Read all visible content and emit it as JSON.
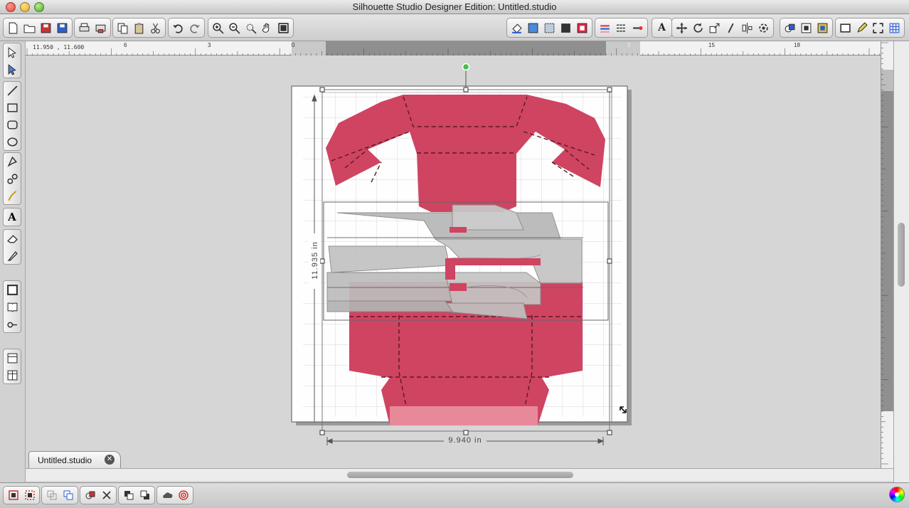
{
  "window": {
    "title": "Silhouette Studio Designer Edition: Untitled.studio"
  },
  "toolbar": {
    "file_buttons": [
      "new-document-icon",
      "open-folder-icon",
      "save-icon",
      "save-to-library-icon"
    ],
    "print_buttons": [
      "print-icon",
      "print-and-cut-icon"
    ],
    "clipboard_buttons": [
      "copy-icon",
      "paste-icon",
      "cut-icon"
    ],
    "history_buttons": [
      "undo-icon",
      "redo-icon"
    ],
    "zoom_buttons": [
      "zoom-in-icon",
      "zoom-out-icon",
      "zoom-select-icon",
      "pan-icon",
      "fit-to-page-icon"
    ],
    "fill_buttons": [
      "fill-color-icon",
      "fill-gradient-icon",
      "fill-pattern-icon",
      "fill-texture-icon",
      "fill-image-icon"
    ],
    "line_buttons": [
      "line-color-icon",
      "line-style-icon",
      "line-end-icon"
    ],
    "text_buttons": [
      "text-style-icon"
    ],
    "transform_buttons": [
      "move-icon",
      "rotate-icon",
      "scale-icon",
      "shear-icon",
      "align-icon",
      "replicate-icon"
    ],
    "panel_buttons": [
      "modify-icon",
      "offset-icon",
      "trace-icon"
    ],
    "cut_buttons": [
      "cut-settings-icon",
      "sketch-icon",
      "fullscreen-icon",
      "grid-icon"
    ]
  },
  "rulers": {
    "coordinate_readout": "11.950 , 11.600",
    "horizontal_labels": [
      "6",
      "3",
      "0",
      "2",
      "15",
      "18"
    ]
  },
  "selection": {
    "height_label": "11.935 in",
    "width_label": "9.940 in"
  },
  "document_tab": {
    "label": "Untitled.studio",
    "close_glyph": "✕"
  },
  "colors": {
    "shape_fill": "#cf4461",
    "overlay_gray": "#b8b8b8",
    "selection_handle": "#ffffff",
    "rotate_handle": "#45c04a"
  }
}
